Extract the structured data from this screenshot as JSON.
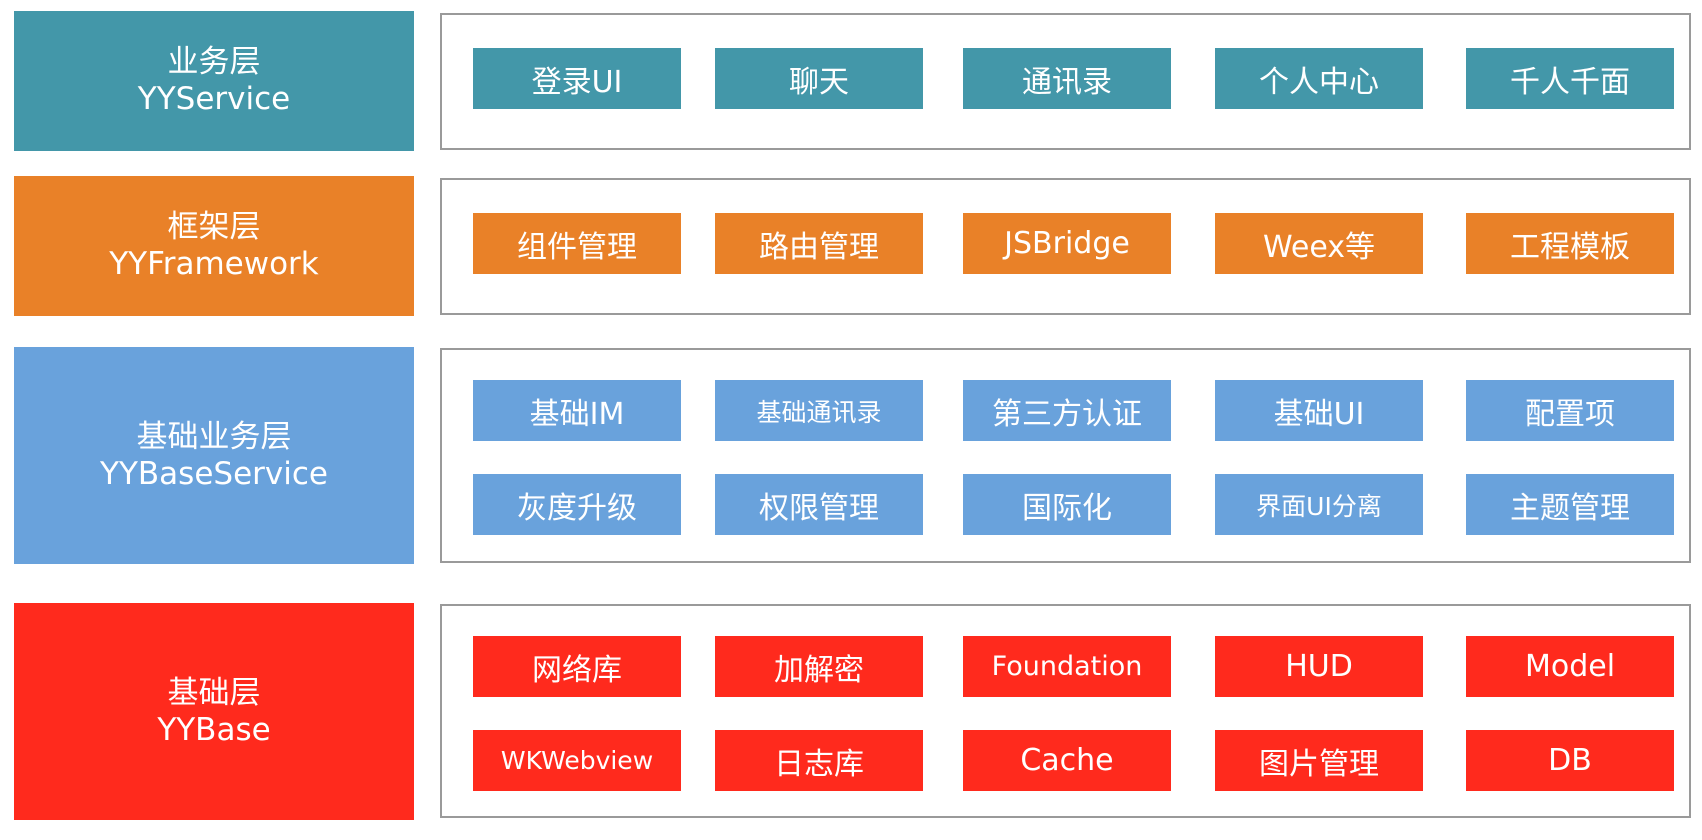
{
  "colors": {
    "service": "#4397a9",
    "framework": "#e98128",
    "baseservice": "#69a2dc",
    "base": "#ff2a1d",
    "panel_border": "#9a9a9a"
  },
  "layers": {
    "service": {
      "title_cn": "业务层",
      "title_en": "YYService",
      "modules": [
        "登录UI",
        "聊天",
        "通讯录",
        "个人中心",
        "千人千面"
      ]
    },
    "framework": {
      "title_cn": "框架层",
      "title_en": "YYFramework",
      "modules": [
        "组件管理",
        "路由管理",
        "JSBridge",
        "Weex等",
        "工程模板"
      ]
    },
    "baseservice": {
      "title_cn": "基础业务层",
      "title_en": "YYBaseService",
      "modules_row1": [
        "基础IM",
        "基础通讯录",
        "第三方认证",
        "基础UI",
        "配置项"
      ],
      "modules_row2": [
        "灰度升级",
        "权限管理",
        "国际化",
        "界面UI分离",
        "主题管理"
      ]
    },
    "base": {
      "title_cn": "基础层",
      "title_en": "YYBase",
      "modules_row1": [
        "网络库",
        "加解密",
        "Foundation",
        "HUD",
        "Model"
      ],
      "modules_row2": [
        "WKWebview",
        "日志库",
        "Cache",
        "图片管理",
        "DB"
      ]
    }
  }
}
